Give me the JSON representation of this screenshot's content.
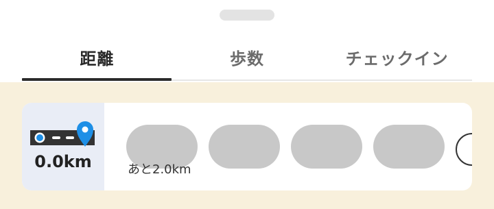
{
  "tabs": [
    {
      "label": "距離",
      "active": true
    },
    {
      "label": "歩数",
      "active": false
    },
    {
      "label": "チェックイン",
      "active": false
    }
  ],
  "distance": {
    "value": "0.0km",
    "remaining": "あと2.0km"
  },
  "colors": {
    "background": "#f8f0dc",
    "active_tab_text": "#2a2a2a",
    "inactive_tab_text": "#6b6b6b",
    "route_pin": "#1e8fe6",
    "placeholder": "#c8c8c8"
  }
}
